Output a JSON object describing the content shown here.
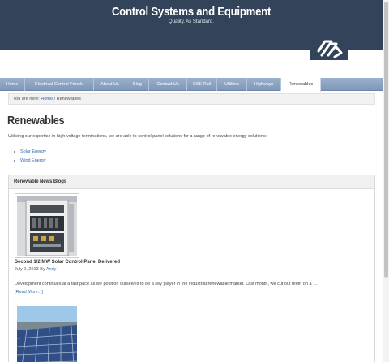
{
  "site": {
    "title": "Control Systems and Equipment",
    "tagline": "Quality. As Standard."
  },
  "colors": {
    "header_bg": "#334359",
    "nav_bg": "#8aa3c4",
    "link": "#3a6aa8"
  },
  "nav": {
    "items": [
      {
        "label": "Home"
      },
      {
        "label": "Electrical Control Panels"
      },
      {
        "label": "About Us"
      },
      {
        "label": "Blog"
      },
      {
        "label": "Contact Us"
      },
      {
        "label": "CSE Rail"
      },
      {
        "label": "Utilities"
      },
      {
        "label": "Highways"
      },
      {
        "label": "Renewables",
        "active": true
      }
    ]
  },
  "breadcrumb": {
    "prefix": "You are here:",
    "home": "Home",
    "separator": "/",
    "current": "Renewables"
  },
  "page": {
    "title": "Renewables",
    "intro": "Utilising our expertise in high voltage terminations, we are able to control panel solutions for a range of renewable energy solutions:",
    "links": [
      "Solar Energy",
      "Wind Energy"
    ]
  },
  "widget": {
    "title": "Renewable News Blogs",
    "posts": [
      {
        "title": "Second 1/2 MW Solar Control Panel Delivered",
        "date": "July 9, 2013",
        "by": "By",
        "author": "Andy",
        "excerpt": "Development continues at a fast pace as we position ourselves to be a key player in the industrial renewable market. Last month, we cut out teeth on a …",
        "read_more": "[Read More...]",
        "icon": "control-panel-photo"
      },
      {
        "icon": "solar-panels-photo"
      }
    ]
  }
}
